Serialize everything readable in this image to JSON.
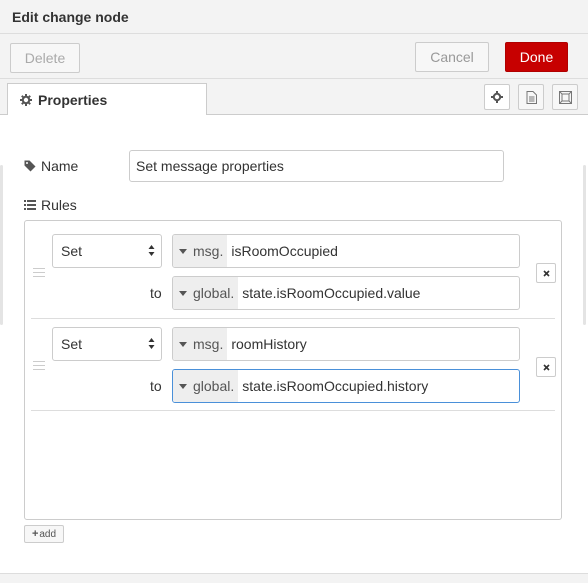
{
  "window": {
    "title": "Edit change node"
  },
  "toolbar": {
    "delete_label": "Delete",
    "cancel_label": "Cancel",
    "done_label": "Done"
  },
  "tabs": [
    {
      "label": "Properties",
      "icon": "gear-icon"
    }
  ],
  "tab_icons": [
    "gear-icon",
    "document-icon",
    "frame-icon"
  ],
  "form": {
    "name_label": "Name",
    "name_value": "Set message properties",
    "rules_label": "Rules"
  },
  "rules": [
    {
      "action": "Set",
      "target_type": "msg.",
      "target_value": "isRoomOccupied",
      "to_label": "to",
      "source_type": "global.",
      "source_value": "state.isRoomOccupied.value"
    },
    {
      "action": "Set",
      "target_type": "msg.",
      "target_value": "roomHistory",
      "to_label": "to",
      "source_type": "global.",
      "source_value": "state.isRoomOccupied.history"
    }
  ],
  "add_label": "add",
  "colors": {
    "done": "#c70000",
    "focus": "#4a90d9"
  }
}
